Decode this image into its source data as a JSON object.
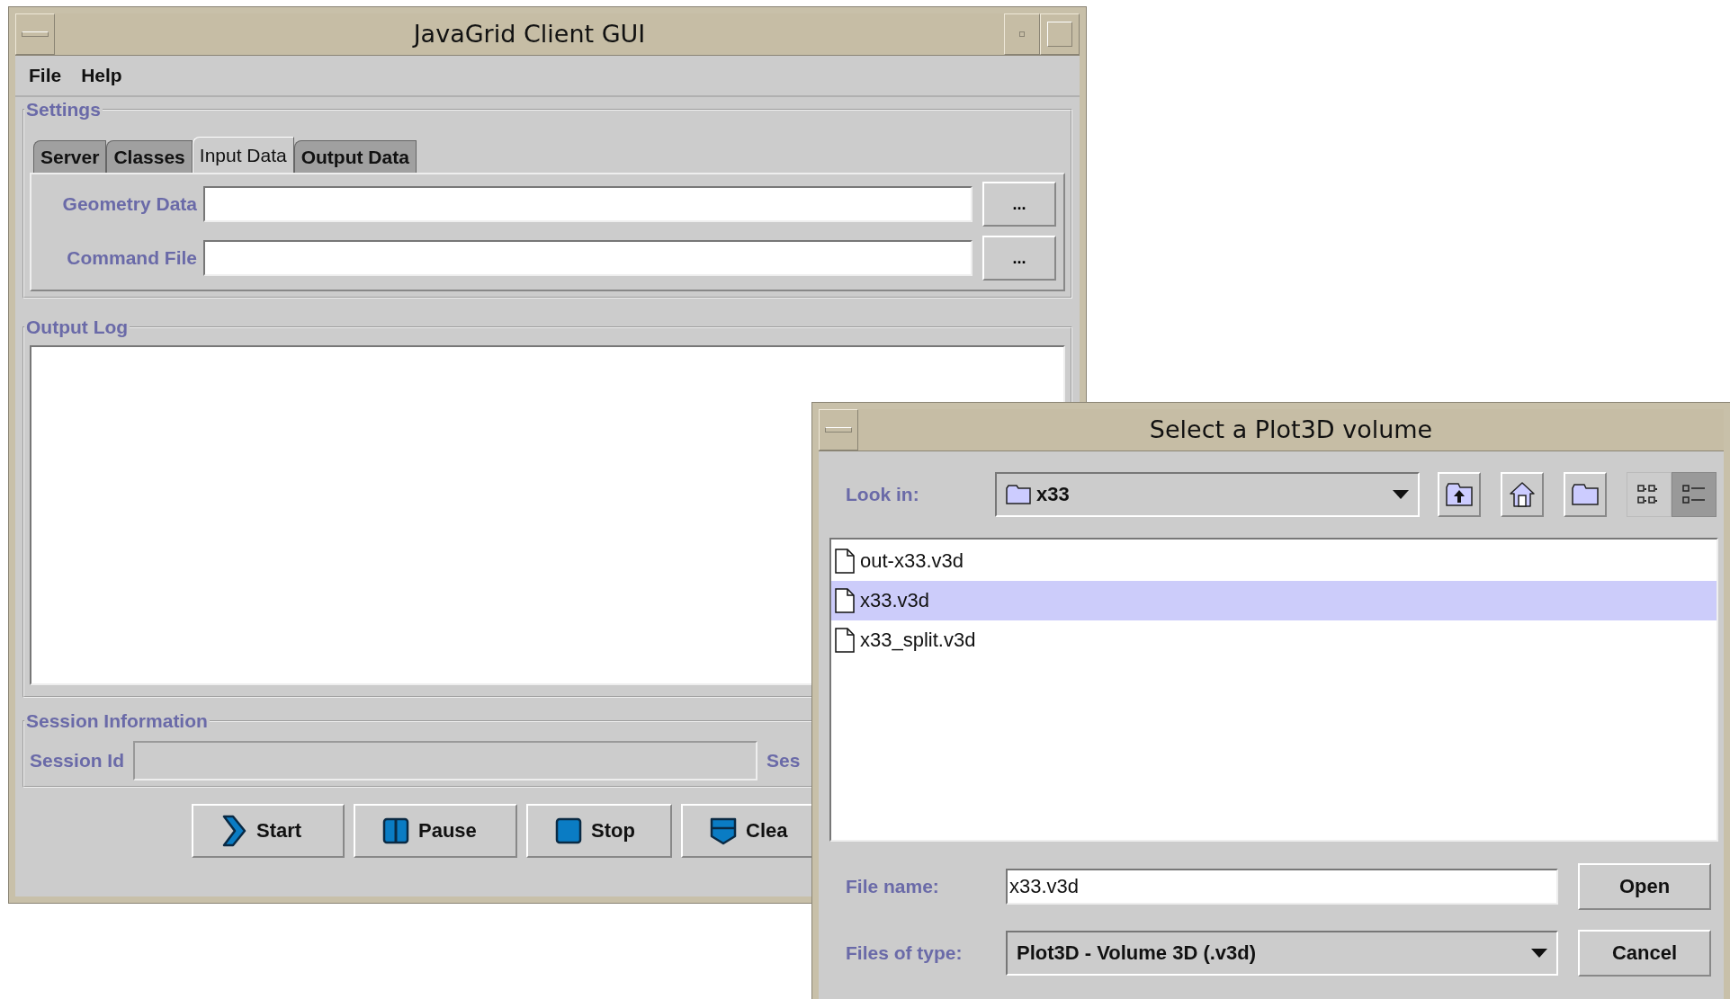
{
  "main_window": {
    "title": "JavaGrid Client GUI",
    "menu": [
      "File",
      "Help"
    ],
    "settings": {
      "title": "Settings",
      "tabs": [
        {
          "label": "Server",
          "selected": false
        },
        {
          "label": "Classes",
          "selected": false
        },
        {
          "label": "Input Data",
          "selected": true
        },
        {
          "label": "Output Data",
          "selected": false
        }
      ],
      "fields": [
        {
          "label": "Geometry Data",
          "browse": "..."
        },
        {
          "label": "Command File",
          "browse": "..."
        }
      ]
    },
    "output_log": {
      "title": "Output Log"
    },
    "session": {
      "title": "Session Information",
      "label": "Session Id",
      "label_2": "Ses"
    },
    "buttons": [
      {
        "label": "Start",
        "kind": "start"
      },
      {
        "label": "Pause",
        "kind": "pause"
      },
      {
        "label": "Stop",
        "kind": "stop"
      },
      {
        "label": "Clea",
        "kind": "clear"
      }
    ]
  },
  "dialog": {
    "title": "Select a Plot3D volume",
    "look_in": {
      "label": "Look in:",
      "value": "x33"
    },
    "view_modes": [
      {
        "kind": "list",
        "selected": false
      },
      {
        "kind": "details",
        "selected": true
      }
    ],
    "files": [
      {
        "name": "out-x33.v3d",
        "selected": false
      },
      {
        "name": "x33.v3d",
        "selected": true
      },
      {
        "name": "x33_split.v3d",
        "selected": false
      }
    ],
    "file_name": {
      "label": "File name:",
      "value": "x33.v3d"
    },
    "file_type": {
      "label": "Files of type:",
      "value": "Plot3D - Volume 3D (.v3d)"
    },
    "buttons": [
      "Open",
      "Cancel"
    ]
  }
}
